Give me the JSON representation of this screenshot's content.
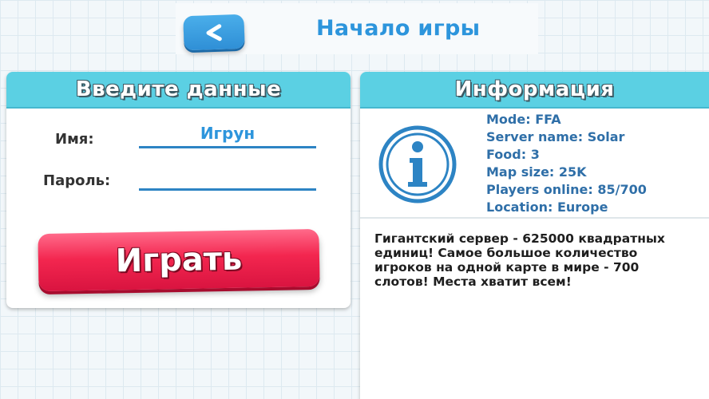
{
  "header": {
    "back_label": "<",
    "title": "Начало игры"
  },
  "login": {
    "title": "Введите данные",
    "name_label": "Имя:",
    "name_value": "Игрун",
    "password_label": "Пароль:",
    "password_value": "",
    "play_label": "Играть"
  },
  "info": {
    "title": "Информация",
    "icon": "info-icon",
    "details": [
      "Mode: FFA",
      "Server name: Solar",
      "Food: 3",
      "Map size: 25K",
      "Players online: 85/700",
      "Location: Europe"
    ],
    "description": "Гигантский сервер - 625000 квадратных единиц! Самое большое количество игроков на одной карте в мире - 700 слотов! Места хватит всем!"
  },
  "colors": {
    "accent_blue": "#2d95dc",
    "panel_header": "#5bd0e3",
    "play_button": "#f3264f",
    "info_text": "#2f6fa8"
  }
}
